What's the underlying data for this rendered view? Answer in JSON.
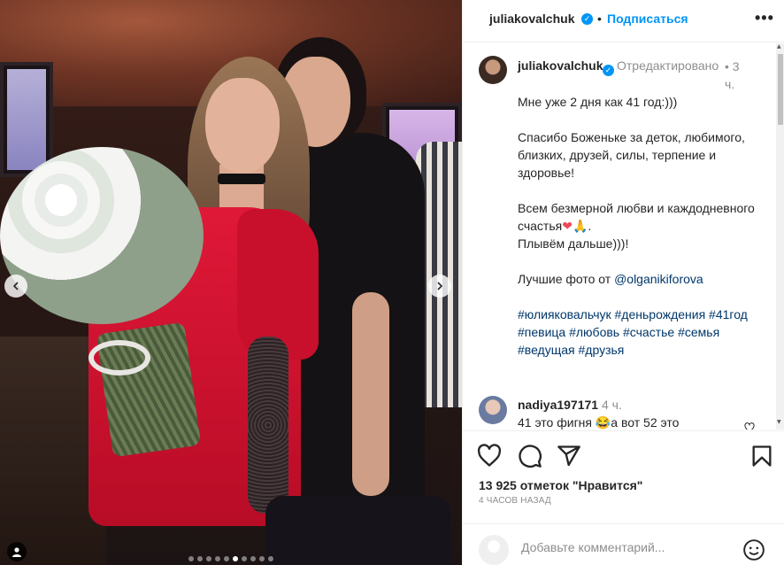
{
  "post": {
    "author": "juliakovalchuk",
    "follow_label": "Подписаться",
    "separator": "•",
    "more_label": "•••"
  },
  "photo": {
    "prev_icon": "chevron-left-icon",
    "next_icon": "chevron-right-icon",
    "slide_count": 10,
    "active_slide": 6
  },
  "caption": {
    "username": "juliakovalchuk",
    "edited": "Отредактировано",
    "dot": "•",
    "time": "3 ч.",
    "line1": "Мне уже 2 дня как 41 год:)))",
    "line2": "Спасибо Боженьке за деток, любимого, близких, друзей, силы, терпение и здоровье!",
    "line3a": "Всем безмерной любви и каждодневного счастья",
    "emoji_heart": "❤",
    "emoji_pray": "🙏",
    "line3b": ".",
    "line4": "Плывём дальше)))!",
    "photo_credit_prefix": "Лучшие фото от ",
    "mention": "@olganikiforova",
    "hashtags": "#юлияковальчук #деньрождения #41год #певица #любовь #счастье #семья #ведущая #друзья"
  },
  "comment2": {
    "username": "nadiya197171",
    "time": "4 ч.",
    "text": "41 это фигня 😂а вот 52 это"
  },
  "actions": {
    "likes": "13 925 отметок \"Нравится\"",
    "time_ago": "4 ЧАСОВ НАЗАД"
  },
  "add_comment": {
    "placeholder": "Добавьте комментарий..."
  },
  "colors": {
    "accent": "#0095f6",
    "link": "#00376b",
    "muted": "#8e8e8e",
    "text": "#262626"
  }
}
